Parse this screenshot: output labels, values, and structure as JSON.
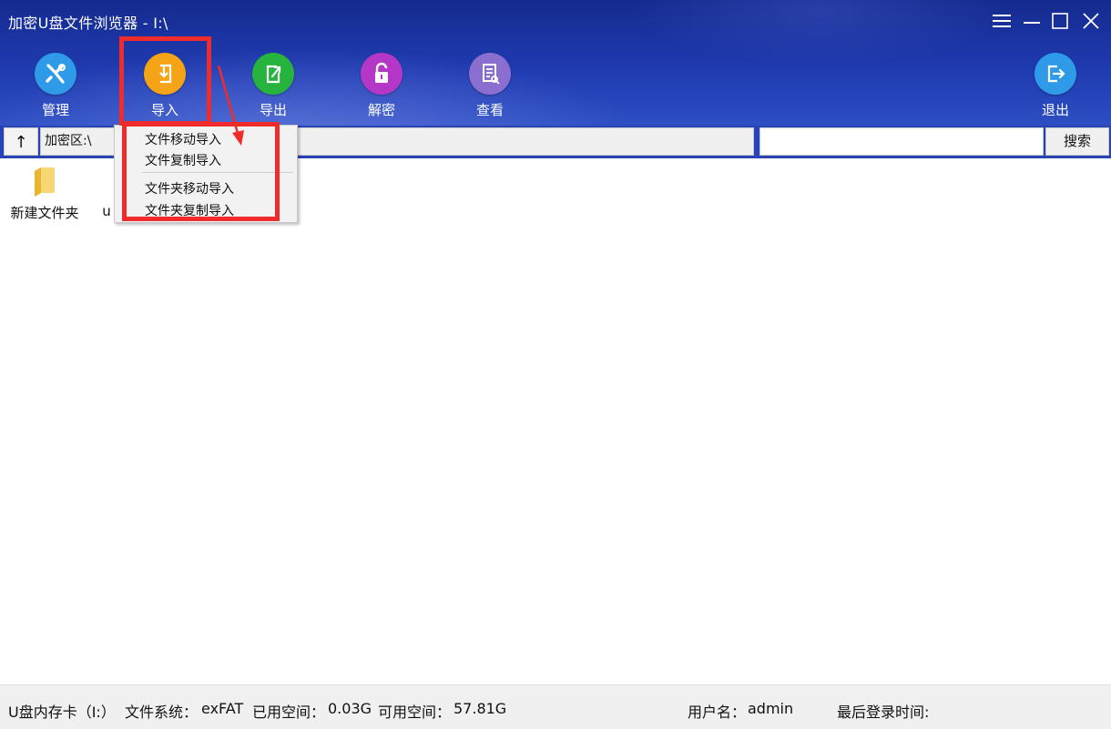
{
  "window": {
    "title": "加密U盘文件浏览器 - I:\\",
    "menu_icon": "hamburger-icon",
    "minimize_icon": "minimize-icon",
    "maximize_icon": "maximize-icon",
    "close_icon": "close-icon"
  },
  "toolbar": {
    "items": [
      {
        "label": "管理",
        "icon": "wrench-screwdriver-icon",
        "color": "#2f9be8"
      },
      {
        "label": "导入",
        "icon": "import-icon",
        "color": "#f5a417"
      },
      {
        "label": "导出",
        "icon": "export-icon",
        "color": "#27b43e"
      },
      {
        "label": "解密",
        "icon": "unlock-icon",
        "color": "#b537c8"
      },
      {
        "label": "查看",
        "icon": "view-document-icon",
        "color": "#8a6fd1"
      }
    ],
    "exit": {
      "label": "退出",
      "icon": "exit-icon",
      "color": "#2f9be8"
    }
  },
  "address": {
    "up_label": "↑",
    "path": "加密区:\\",
    "search_value": "",
    "search_button": "搜索"
  },
  "import_menu": {
    "items": [
      "文件移动导入",
      "文件复制导入",
      "文件夹移动导入",
      "文件夹复制导入"
    ]
  },
  "files": [
    {
      "name": "新建文件夹",
      "icon": "folder-icon"
    },
    {
      "name": "u",
      "icon": ""
    }
  ],
  "status": {
    "drive": "U盘内存卡（I:）",
    "fs_label": "文件系统：",
    "fs_value": "exFAT",
    "used_label": "已用空间：",
    "used_value": "0.03G",
    "free_label": "可用空间：",
    "free_value": "57.81G",
    "user_label": "用户名：",
    "user_value": "admin",
    "login_label": "最后登录时间:",
    "login_value": ""
  },
  "annotation_color": "#f02b2b"
}
